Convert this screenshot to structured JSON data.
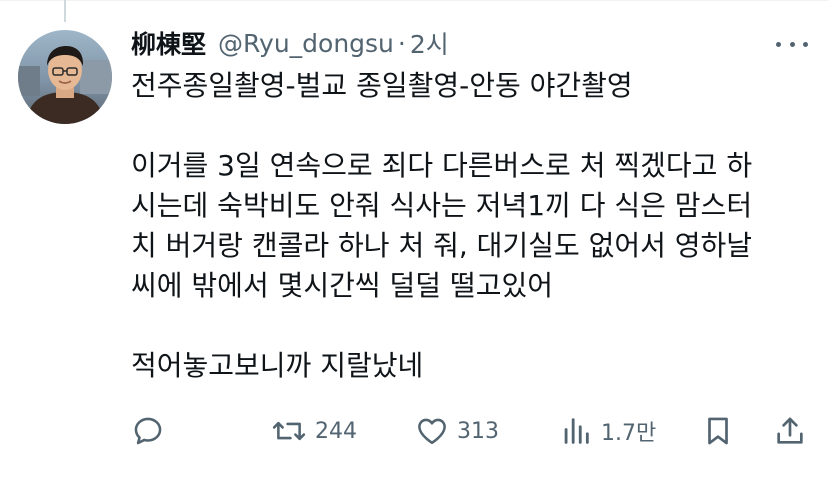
{
  "author": {
    "display_name": "柳棟堅",
    "handle": "@Ryu_dongsu",
    "separator": "·",
    "time": "2시"
  },
  "tweet": {
    "lines": [
      "전주종일촬영-벌교 종일촬영-안동 야간촬영",
      "",
      "이거를 3일 연속으로 죄다 다른버스로 처 찍겠다고 하",
      "시는데 숙박비도 안줘 식사는 저녁1끼 다 식은 맘스터",
      "치 버거랑 캔콜라 하나 처 줘, 대기실도 없어서 영하날",
      "씨에 밖에서 몇시간씩 덜덜 떨고있어",
      "",
      "적어놓고보니까 지랄났네"
    ]
  },
  "actions": {
    "retweets": "244",
    "likes": "313",
    "views": "1.7만"
  },
  "icons": {
    "more": "more-icon",
    "reply": "reply-icon",
    "retweet": "retweet-icon",
    "like": "heart-icon",
    "views": "analytics-icon",
    "bookmark": "bookmark-icon",
    "share": "share-icon"
  },
  "colors": {
    "text": "#0f1419",
    "secondary": "#536471",
    "background": "#ffffff"
  }
}
